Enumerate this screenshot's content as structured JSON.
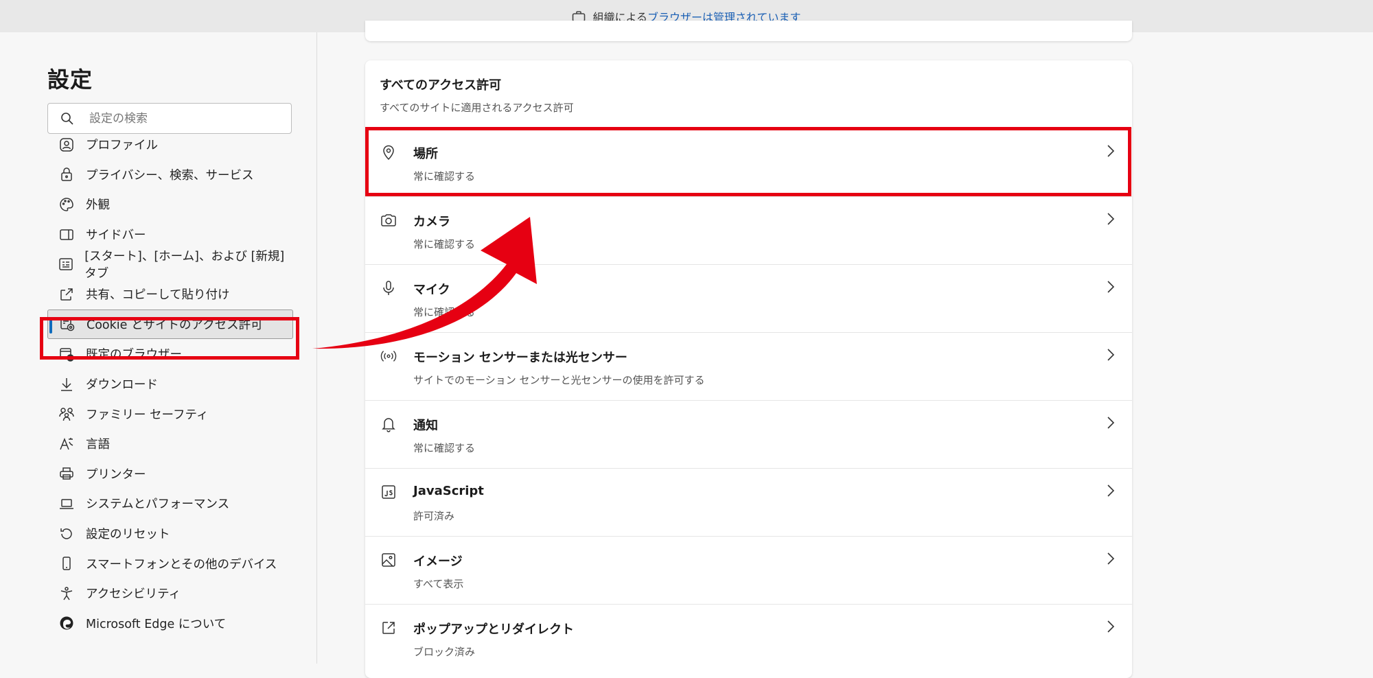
{
  "topbar": {
    "prefix": "組織による",
    "link": "ブラウザーは管理されています"
  },
  "sidebar": {
    "title": "設定",
    "search_placeholder": "設定の検索",
    "items": [
      {
        "label": "プロファイル",
        "icon": "profile-icon"
      },
      {
        "label": "プライバシー、検索、サービス",
        "icon": "lock-icon"
      },
      {
        "label": "外観",
        "icon": "palette-icon"
      },
      {
        "label": "サイドバー",
        "icon": "sidebar-icon"
      },
      {
        "label": "[スタート]、[ホーム]、および [新規] タブ",
        "icon": "newtab-icon"
      },
      {
        "label": "共有、コピーして貼り付け",
        "icon": "share-icon"
      },
      {
        "label": "Cookie とサイトのアクセス許可",
        "icon": "cookie-permissions-icon",
        "active": true
      },
      {
        "label": "既定のブラウザー",
        "icon": "default-browser-icon"
      },
      {
        "label": "ダウンロード",
        "icon": "download-icon"
      },
      {
        "label": "ファミリー セーフティ",
        "icon": "family-icon"
      },
      {
        "label": "言語",
        "icon": "language-icon"
      },
      {
        "label": "プリンター",
        "icon": "printer-icon"
      },
      {
        "label": "システムとパフォーマンス",
        "icon": "laptop-icon"
      },
      {
        "label": "設定のリセット",
        "icon": "reset-icon"
      },
      {
        "label": "スマートフォンとその他のデバイス",
        "icon": "phone-icon"
      },
      {
        "label": "アクセシビリティ",
        "icon": "accessibility-icon"
      },
      {
        "label": "Microsoft Edge について",
        "icon": "edge-icon"
      }
    ]
  },
  "main": {
    "section_title": "すべてのアクセス許可",
    "section_subtitle": "すべてのサイトに適用されるアクセス許可",
    "rows": [
      {
        "title": "場所",
        "subtitle": "常に確認する",
        "icon": "location-icon"
      },
      {
        "title": "カメラ",
        "subtitle": "常に確認する",
        "icon": "camera-icon"
      },
      {
        "title": "マイク",
        "subtitle": "常に確認する",
        "icon": "microphone-icon"
      },
      {
        "title": "モーション センサーまたは光センサー",
        "subtitle": "サイトでのモーション センサーと光センサーの使用を許可する",
        "icon": "sensor-icon"
      },
      {
        "title": "通知",
        "subtitle": "常に確認する",
        "icon": "bell-icon"
      },
      {
        "title": "JavaScript",
        "subtitle": "許可済み",
        "icon": "javascript-icon"
      },
      {
        "title": "イメージ",
        "subtitle": "すべて表示",
        "icon": "image-icon"
      },
      {
        "title": "ポップアップとリダイレクト",
        "subtitle": "ブロック済み",
        "icon": "popup-icon"
      }
    ]
  },
  "colors": {
    "highlight": "#e60012",
    "accent": "#0f6cbd",
    "link": "#1a5fb4"
  }
}
